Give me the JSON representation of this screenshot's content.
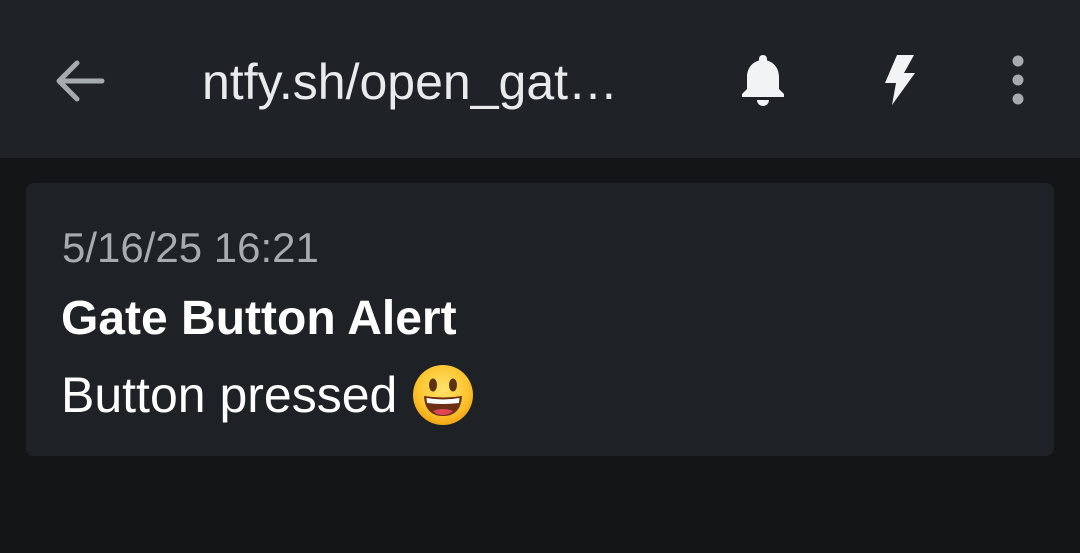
{
  "topbar": {
    "title": "ntfy.sh/open_gat…",
    "icons": {
      "back": "arrow-left-icon",
      "notifications": "bell-icon",
      "instant_delivery": "lightning-bolt-icon",
      "more": "more-vertical-icon"
    }
  },
  "message": {
    "timestamp": "5/16/25 16:21",
    "title": "Gate Button Alert",
    "body": "Button pressed",
    "emoji": "grinning-face-emoji"
  },
  "colors": {
    "background": "#141516",
    "appbar": "#1f2327",
    "card": "#1e2226",
    "text_primary": "#ffffff",
    "text_secondary": "#a6abb0"
  }
}
